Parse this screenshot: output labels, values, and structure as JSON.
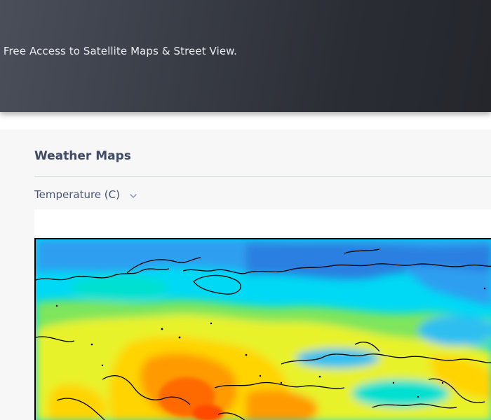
{
  "hero": {
    "tagline": "t Free Access to Satellite Maps & Street View."
  },
  "weather": {
    "section_title": "Weather Maps",
    "layer_selector": {
      "selected": "Temperature (C)",
      "icon": "chevron-down-icon"
    },
    "map": {
      "layer": "temperature",
      "palette": [
        "#2a6fd6",
        "#2f9ff0",
        "#00d9f5",
        "#00e0d0",
        "#7ee55c",
        "#e8f22a",
        "#ffd400",
        "#ff9a00",
        "#ff5a00"
      ]
    }
  },
  "colors": {
    "hero_background": "#2d3038",
    "hero_text": "#e9ebef",
    "title": "#3f4a66",
    "content_background": "#f7f7f8"
  }
}
